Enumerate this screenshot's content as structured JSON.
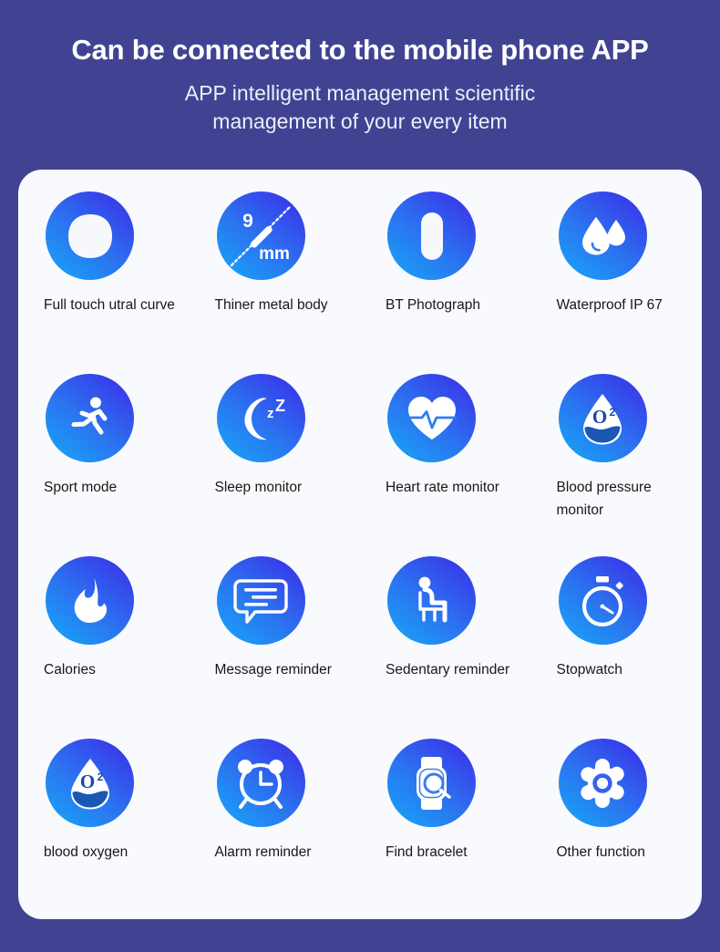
{
  "header": {
    "headline": "Can be connected to the mobile phone APP",
    "subhead_line1": "APP intelligent management scientific",
    "subhead_line2": "management of your every item"
  },
  "theme": {
    "page_background": "#414392",
    "card_background": "#f9fafd",
    "badge_gradient_start": "#15a9f7",
    "badge_gradient_end": "#3c2ae8",
    "label_color": "#181818",
    "icon_color": "#ffffff"
  },
  "features": [
    {
      "label": "Full touch utral curve",
      "icon": "squircle-screen-icon"
    },
    {
      "label": "Thiner metal body",
      "icon": "thickness-ruler-icon",
      "value": "9",
      "unit": "mm"
    },
    {
      "label": "BT Photograph",
      "icon": "capsule-shutter-icon"
    },
    {
      "label": "Waterproof IP 67",
      "icon": "water-drops-icon"
    },
    {
      "label": "Sport mode",
      "icon": "running-person-icon"
    },
    {
      "label": "Sleep monitor",
      "icon": "moon-zzz-icon",
      "value": "z"
    },
    {
      "label": "Heart rate monitor",
      "icon": "heart-pulse-icon"
    },
    {
      "label": "Blood pressure monitor",
      "icon": "oxygen-drop-icon",
      "value": "O²"
    },
    {
      "label": "Calories",
      "icon": "flame-icon"
    },
    {
      "label": "Message reminder",
      "icon": "speech-bubble-icon"
    },
    {
      "label": "Sedentary reminder",
      "icon": "seated-person-icon"
    },
    {
      "label": "Stopwatch",
      "icon": "stopwatch-icon"
    },
    {
      "label": "blood oxygen",
      "icon": "oxygen-drop-icon",
      "value": "O²"
    },
    {
      "label": "Alarm reminder",
      "icon": "alarm-clock-icon"
    },
    {
      "label": "Find bracelet",
      "icon": "watch-search-icon"
    },
    {
      "label": "Other function",
      "icon": "gear-icon"
    }
  ]
}
